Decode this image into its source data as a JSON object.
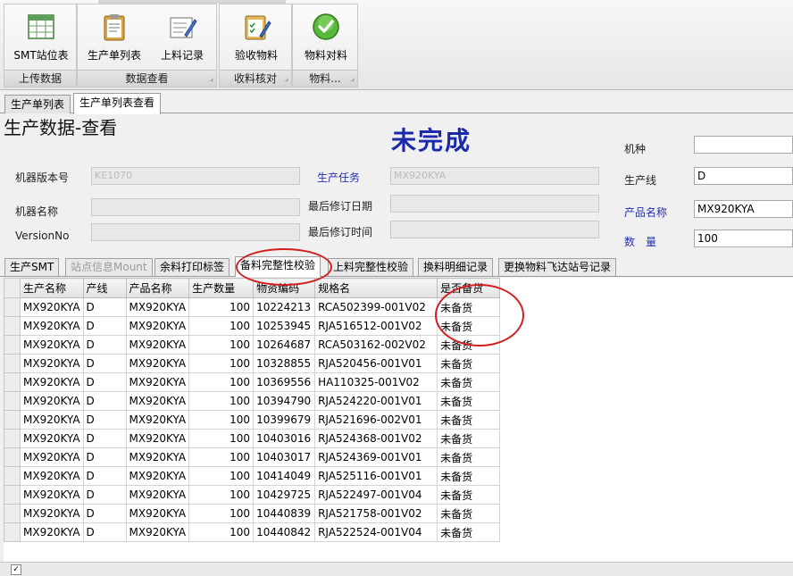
{
  "ribbon": {
    "groups": [
      {
        "label": "上传数据",
        "buttons": [
          {
            "label": "SMT站位表",
            "icon": "table-grid-icon"
          }
        ]
      },
      {
        "label": "数据查看",
        "buttons": [
          {
            "label": "生产单列表",
            "icon": "clipboard-icon"
          },
          {
            "label": "上料记录",
            "icon": "edit-record-icon"
          }
        ]
      },
      {
        "label": "收料核对",
        "buttons": [
          {
            "label": "验收物料",
            "icon": "checklist-pencil-icon"
          }
        ]
      },
      {
        "label": "物料...",
        "buttons": [
          {
            "label": "物料对料",
            "icon": "green-check-icon"
          }
        ]
      }
    ]
  },
  "doc_tabs": [
    "生产单列表",
    "生产单列表查看"
  ],
  "page_title": "生产数据-查看",
  "status_text": "未完成",
  "form": {
    "machine_version": {
      "label": "机器版本号",
      "value": "KE1070"
    },
    "machine_name": {
      "label": "机器名称",
      "value": ""
    },
    "version_no": {
      "label": "VersionNo",
      "value": ""
    },
    "production_task": {
      "label": "生产任务",
      "value": "MX920KYA"
    },
    "last_revision_date": {
      "label": "最后修订日期",
      "value": ""
    },
    "last_revision_time": {
      "label": "最后修订时间",
      "value": ""
    },
    "model_type": {
      "label": "机种",
      "value": ""
    },
    "production_line": {
      "label": "生产线",
      "value": "D"
    },
    "product_name": {
      "label": "产品名称",
      "value": "MX920KYA"
    },
    "quantity": {
      "label": "数　量",
      "value": "100"
    }
  },
  "sub_tabs": [
    "生产SMT",
    "站点信息Mount",
    "余料打印标签",
    "备料完整性校验",
    "上料完整性校验",
    "换料明细记录",
    "更换物料飞达站号记录"
  ],
  "grid": {
    "columns": [
      "生产名称",
      "产线",
      "产品名称",
      "生产数量",
      "物资编码",
      "规格名",
      "是否备货"
    ],
    "rows": [
      [
        "MX920KYA",
        "D",
        "MX920KYA",
        "100",
        "10224213",
        "RCA502399-001V02",
        "未备货"
      ],
      [
        "MX920KYA",
        "D",
        "MX920KYA",
        "100",
        "10253945",
        "RJA516512-001V02",
        "未备货"
      ],
      [
        "MX920KYA",
        "D",
        "MX920KYA",
        "100",
        "10264687",
        "RCA503162-002V02",
        "未备货"
      ],
      [
        "MX920KYA",
        "D",
        "MX920KYA",
        "100",
        "10328855",
        "RJA520456-001V01",
        "未备货"
      ],
      [
        "MX920KYA",
        "D",
        "MX920KYA",
        "100",
        "10369556",
        "HA110325-001V02",
        "未备货"
      ],
      [
        "MX920KYA",
        "D",
        "MX920KYA",
        "100",
        "10394790",
        "RJA524220-001V01",
        "未备货"
      ],
      [
        "MX920KYA",
        "D",
        "MX920KYA",
        "100",
        "10399679",
        "RJA521696-002V01",
        "未备货"
      ],
      [
        "MX920KYA",
        "D",
        "MX920KYA",
        "100",
        "10403016",
        "RJA524368-001V02",
        "未备货"
      ],
      [
        "MX920KYA",
        "D",
        "MX920KYA",
        "100",
        "10403017",
        "RJA524369-001V01",
        "未备货"
      ],
      [
        "MX920KYA",
        "D",
        "MX920KYA",
        "100",
        "10414049",
        "RJA525116-001V01",
        "未备货"
      ],
      [
        "MX920KYA",
        "D",
        "MX920KYA",
        "100",
        "10429725",
        "RJA522497-001V04",
        "未备货"
      ],
      [
        "MX920KYA",
        "D",
        "MX920KYA",
        "100",
        "10440839",
        "RJA521758-001V02",
        "未备货"
      ],
      [
        "MX920KYA",
        "D",
        "MX920KYA",
        "100",
        "10440842",
        "RJA522524-001V04",
        "未备货"
      ]
    ]
  },
  "colors": {
    "status_text": "#1b2aa8",
    "blue_label": "#2231b0",
    "annotation_red": "#d21f1f"
  }
}
